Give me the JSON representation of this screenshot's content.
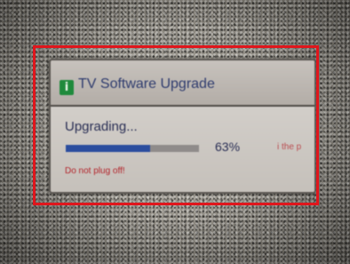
{
  "dialog": {
    "title": "TV Software Upgrade",
    "info_icon_glyph": "i",
    "icon": "info-icon",
    "status": "Upgrading...",
    "progress_label": "63%",
    "progress_fraction": 0.63,
    "background_text": "i the p",
    "warning": "Do not plug off!"
  },
  "colors": {
    "highlight_frame": "#e0161c",
    "progress_fill": "#2b4d9e",
    "warning_text": "#b3242b",
    "info_icon": "#1f8a3c"
  }
}
